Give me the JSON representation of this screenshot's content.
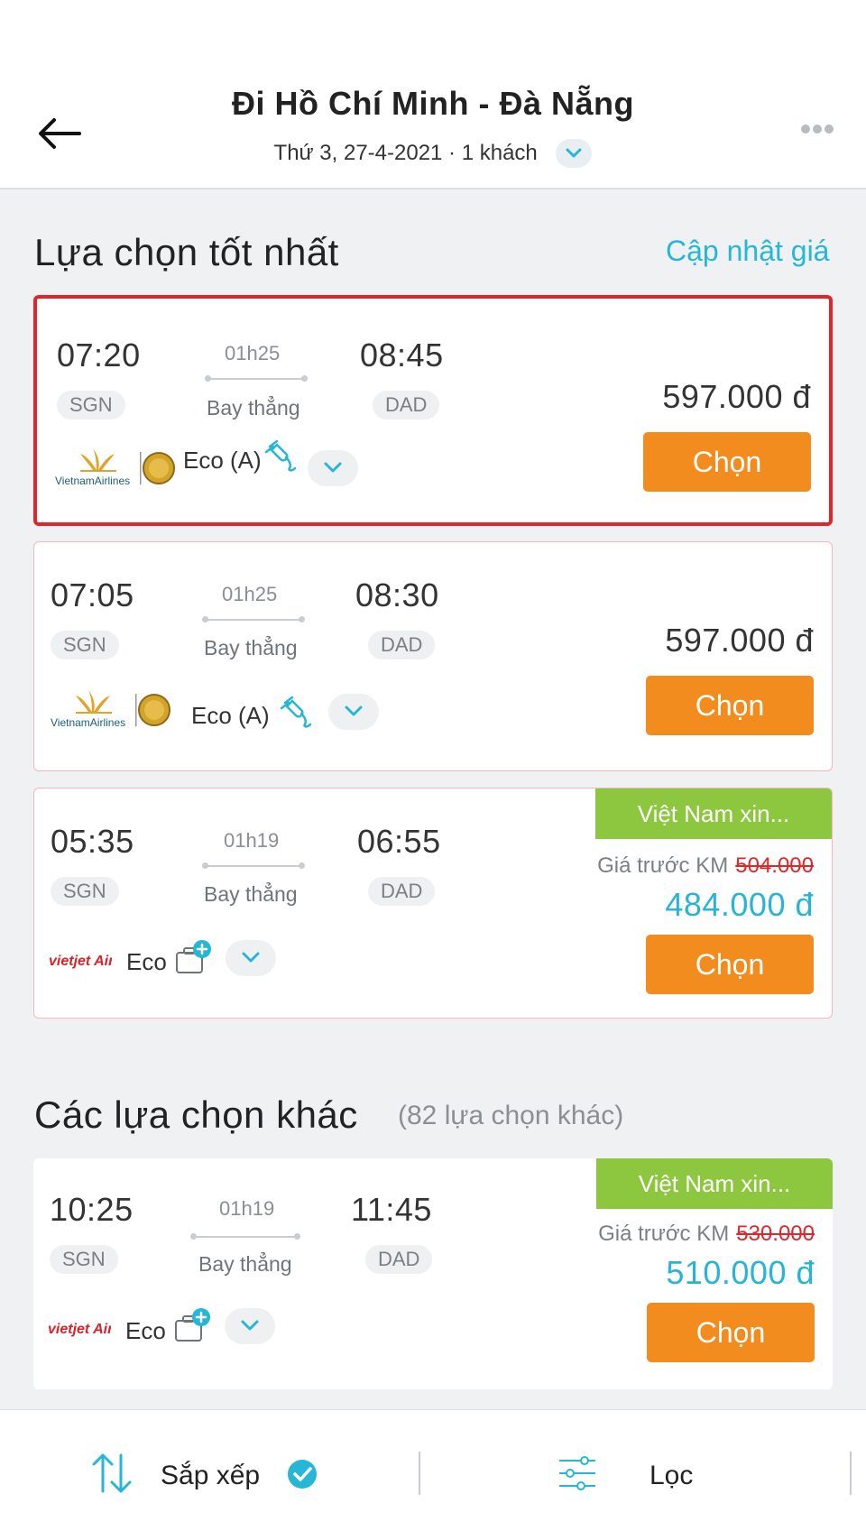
{
  "header": {
    "title": "Đi Hồ Chí Minh - Đà Nẵng",
    "subtitle": "Thứ 3, 27-4-2021 · 1 khách"
  },
  "best": {
    "title": "Lựa chọn tốt nhất",
    "update_link": "Cập nhật giá"
  },
  "others": {
    "title": "Các lựa chọn khác",
    "note": "(82 lựa chọn khác)"
  },
  "flights": [
    {
      "depart": "07:20",
      "arrive": "08:45",
      "duration": "01h25",
      "stops": "Bay thẳng",
      "from": "SGN",
      "to": "DAD",
      "airline": "Vietnam Airlines",
      "airline_logo_text": "VietnamAirlines",
      "class": "Eco (A)",
      "price": "597.000 đ",
      "button": "Chọn"
    },
    {
      "depart": "07:05",
      "arrive": "08:30",
      "duration": "01h25",
      "stops": "Bay thẳng",
      "from": "SGN",
      "to": "DAD",
      "airline": "Vietnam Airlines",
      "airline_logo_text": "VietnamAirlines",
      "class": "Eco (A)",
      "price": "597.000 đ",
      "button": "Chọn"
    },
    {
      "depart": "05:35",
      "arrive": "06:55",
      "duration": "01h19",
      "stops": "Bay thẳng",
      "from": "SGN",
      "to": "DAD",
      "airline": "VietJet Air",
      "airline_logo_text": "vietjet Air.com",
      "class": "Eco",
      "promo_tag": "Việt Nam xin...",
      "old_price_label": "Giá trước KM",
      "old_price": "504.000",
      "price": "484.000 đ",
      "button": "Chọn"
    },
    {
      "depart": "10:25",
      "arrive": "11:45",
      "duration": "01h19",
      "stops": "Bay thẳng",
      "from": "SGN",
      "to": "DAD",
      "airline": "VietJet Air",
      "airline_logo_text": "vietjet Air.com",
      "class": "Eco",
      "promo_tag": "Việt Nam xin...",
      "old_price_label": "Giá trước KM",
      "old_price": "530.000",
      "price": "510.000 đ",
      "button": "Chọn"
    }
  ],
  "bottom_bar": {
    "sort_label": "Sắp xếp",
    "filter_label": "Lọc"
  },
  "colors": {
    "accent": "#27b7d6",
    "button": "#f28c1e",
    "selected_border": "#e0252b",
    "promo_tag": "#8dc63f"
  }
}
